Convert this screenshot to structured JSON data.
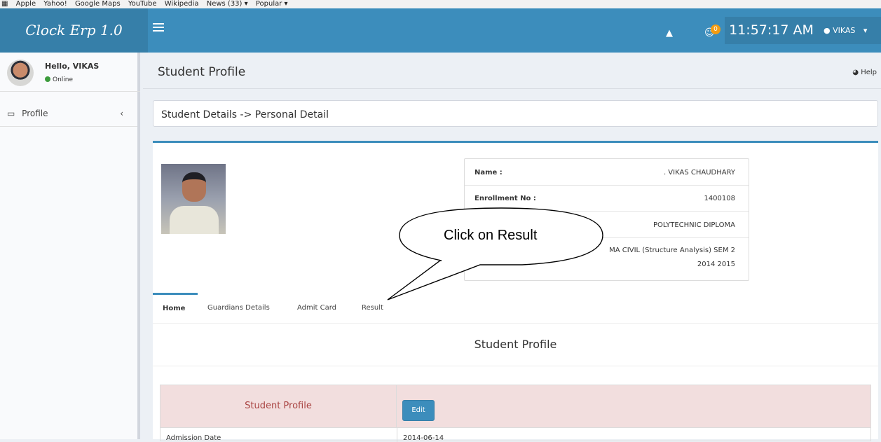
{
  "bookmarks": [
    "Apple",
    "Yahoo!",
    "Google Maps",
    "YouTube",
    "Wikipedia",
    "News (33) ▾",
    "Popular ▾"
  ],
  "header": {
    "logo": "Clock Erp 1.0",
    "notification_count": "0",
    "clock": "11:57:17 AM",
    "user": "VIKAS"
  },
  "sidebar": {
    "greeting": "Hello, VIKAS",
    "status": "Online",
    "items": [
      {
        "label": "Profile"
      }
    ]
  },
  "content": {
    "page_title": "Student Profile",
    "help": "Help",
    "breadcrumb": "Student Details -> Personal Detail"
  },
  "student": {
    "rows": [
      {
        "key": "Name :",
        "value": ". VIKAS CHAUDHARY"
      },
      {
        "key": "Enrollment No :",
        "value": "1400108"
      },
      {
        "key": "",
        "value": "POLYTECHNIC DIPLOMA"
      },
      {
        "key": "",
        "value": "MA CIVIL (Structure Analysis) SEM 2"
      },
      {
        "key": "",
        "value": "2014 2015"
      }
    ]
  },
  "tabs": [
    {
      "label": "Home"
    },
    {
      "label": "Guardians Details"
    },
    {
      "label": "Admit Card"
    },
    {
      "label": "Result"
    }
  ],
  "profile_section": {
    "heading": "Student Profile",
    "table_title": "Student Profile",
    "edit_label": "Edit",
    "admission_label": "Admission Date",
    "admission_value": "2014-06-14"
  },
  "callout": {
    "text": "Click on Result"
  },
  "colors": {
    "primary": "#3c8dbc",
    "primary_dark": "#367fa9",
    "danger_bg": "#f2dede",
    "danger_text": "#a94442"
  }
}
